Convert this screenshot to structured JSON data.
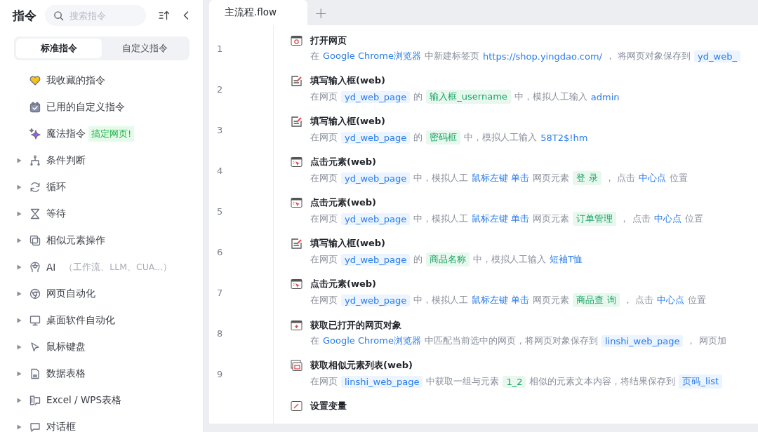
{
  "sidebar": {
    "title": "指令",
    "search": {
      "placeholder": "搜索指令"
    },
    "tabs": [
      {
        "label": "标准指令",
        "selected": true
      },
      {
        "label": "自定义指令",
        "selected": false
      }
    ],
    "items": [
      {
        "kind": "special",
        "label": "我收藏的指令"
      },
      {
        "kind": "special",
        "label": "已用的自定义指令"
      },
      {
        "kind": "special",
        "label": "魔法指令",
        "badge": "搞定网页!"
      },
      {
        "kind": "group",
        "label": "条件判断",
        "expanded": false
      },
      {
        "kind": "group",
        "label": "循环",
        "expanded": false
      },
      {
        "kind": "group",
        "label": "等待",
        "expanded": false
      },
      {
        "kind": "group",
        "label": "相似元素操作",
        "expanded": false
      },
      {
        "kind": "group",
        "label": "AI",
        "note": "（工作流、LLM、CUA...）",
        "expanded": false
      },
      {
        "kind": "group",
        "label": "网页自动化",
        "expanded": false
      },
      {
        "kind": "group",
        "label": "桌面软件自动化",
        "expanded": false
      },
      {
        "kind": "group",
        "label": "鼠标键盘",
        "expanded": false
      },
      {
        "kind": "group",
        "label": "数据表格",
        "expanded": false
      },
      {
        "kind": "group",
        "label": "Excel / WPS表格",
        "expanded": false
      },
      {
        "kind": "group",
        "label": "对话框",
        "expanded": false
      }
    ]
  },
  "editor": {
    "tabs": [
      {
        "label": "主流程.flow",
        "selected": true
      }
    ],
    "add": "+",
    "steps": [
      {
        "number": "1",
        "title": "打开网页",
        "desc": [
          {
            "kind": "text",
            "text": "在"
          },
          {
            "kind": "value",
            "text": "Google Chrome浏览器"
          },
          {
            "kind": "text",
            "text": "中新建标签页"
          },
          {
            "kind": "value",
            "text": "https://shop.yingdao.com/"
          },
          {
            "kind": "text",
            "text": "， 将网页对象保存到"
          },
          {
            "kind": "var",
            "text": "yd_web_"
          }
        ]
      },
      {
        "number": "2",
        "title": "填写输入框(web)",
        "desc": [
          {
            "kind": "text",
            "text": "在网页"
          },
          {
            "kind": "var",
            "text": "yd_web_page"
          },
          {
            "kind": "text",
            "text": "的"
          },
          {
            "kind": "element",
            "text": "输入框_username"
          },
          {
            "kind": "text",
            "text": "中，模拟人工输入"
          },
          {
            "kind": "value",
            "text": "admin"
          }
        ]
      },
      {
        "number": "3",
        "title": "填写输入框(web)",
        "desc": [
          {
            "kind": "text",
            "text": "在网页"
          },
          {
            "kind": "var",
            "text": "yd_web_page"
          },
          {
            "kind": "text",
            "text": "的"
          },
          {
            "kind": "element",
            "text": "密码框"
          },
          {
            "kind": "text",
            "text": "中，模拟人工输入"
          },
          {
            "kind": "value",
            "text": "58T2$!hm"
          }
        ]
      },
      {
        "number": "4",
        "title": "点击元素(web)",
        "desc": [
          {
            "kind": "text",
            "text": "在网页"
          },
          {
            "kind": "var",
            "text": "yd_web_page"
          },
          {
            "kind": "text",
            "text": "中，模拟人工"
          },
          {
            "kind": "value",
            "text": "鼠标左键 单击"
          },
          {
            "kind": "text",
            "text": "网页元素"
          },
          {
            "kind": "element",
            "text": "登 录"
          },
          {
            "kind": "text",
            "text": "， 点击"
          },
          {
            "kind": "value",
            "text": "中心点"
          },
          {
            "kind": "text",
            "text": "位置"
          }
        ]
      },
      {
        "number": "5",
        "title": "点击元素(web)",
        "desc": [
          {
            "kind": "text",
            "text": "在网页"
          },
          {
            "kind": "var",
            "text": "yd_web_page"
          },
          {
            "kind": "text",
            "text": "中，模拟人工"
          },
          {
            "kind": "value",
            "text": "鼠标左键 单击"
          },
          {
            "kind": "text",
            "text": "网页元素"
          },
          {
            "kind": "element",
            "text": "订单管理"
          },
          {
            "kind": "text",
            "text": "， 点击"
          },
          {
            "kind": "value",
            "text": "中心点"
          },
          {
            "kind": "text",
            "text": "位置"
          }
        ]
      },
      {
        "number": "6",
        "title": "填写输入框(web)",
        "desc": [
          {
            "kind": "text",
            "text": "在网页"
          },
          {
            "kind": "var",
            "text": "yd_web_page"
          },
          {
            "kind": "text",
            "text": "的"
          },
          {
            "kind": "element",
            "text": "商品名称"
          },
          {
            "kind": "text",
            "text": "中，模拟人工输入"
          },
          {
            "kind": "value",
            "text": "短袖T恤"
          }
        ]
      },
      {
        "number": "7",
        "title": "点击元素(web)",
        "desc": [
          {
            "kind": "text",
            "text": "在网页"
          },
          {
            "kind": "var",
            "text": "yd_web_page"
          },
          {
            "kind": "text",
            "text": "中，模拟人工"
          },
          {
            "kind": "value",
            "text": "鼠标左键 单击"
          },
          {
            "kind": "text",
            "text": "网页元素"
          },
          {
            "kind": "element",
            "text": "商品查 询"
          },
          {
            "kind": "text",
            "text": "， 点击"
          },
          {
            "kind": "value",
            "text": "中心点"
          },
          {
            "kind": "text",
            "text": "位置"
          }
        ]
      },
      {
        "number": "8",
        "title": "获取已打开的网页对象",
        "desc": [
          {
            "kind": "text",
            "text": "在"
          },
          {
            "kind": "value",
            "text": "Google Chrome浏览器"
          },
          {
            "kind": "text",
            "text": "中匹配当前选中的网页，将网页对象保存到"
          },
          {
            "kind": "var",
            "text": "linshi_web_page"
          },
          {
            "kind": "text",
            "text": "， 网页加"
          }
        ]
      },
      {
        "number": "9",
        "title": "获取相似元素列表(web)",
        "desc": [
          {
            "kind": "text",
            "text": "在网页"
          },
          {
            "kind": "var",
            "text": "linshi_web_page"
          },
          {
            "kind": "text",
            "text": "中获取一组与元素"
          },
          {
            "kind": "element",
            "text": "1_2"
          },
          {
            "kind": "text",
            "text": "相似的元素文本内容，将结果保存到"
          },
          {
            "kind": "var",
            "text": "页码_list"
          }
        ]
      },
      {
        "title": "设置变量"
      }
    ]
  }
}
